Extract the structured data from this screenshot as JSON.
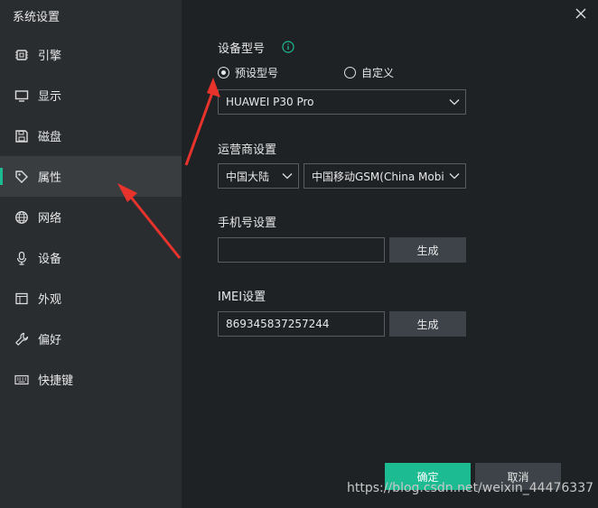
{
  "window": {
    "title": "系统设置"
  },
  "sidebar": {
    "items": [
      {
        "label": "引擎",
        "icon": "chip-icon"
      },
      {
        "label": "显示",
        "icon": "monitor-icon"
      },
      {
        "label": "磁盘",
        "icon": "floppy-disk-icon"
      },
      {
        "label": "属性",
        "icon": "tag-icon",
        "active": true
      },
      {
        "label": "网络",
        "icon": "globe-icon"
      },
      {
        "label": "设备",
        "icon": "microphone-icon"
      },
      {
        "label": "外观",
        "icon": "window-icon"
      },
      {
        "label": "偏好",
        "icon": "wrench-icon"
      },
      {
        "label": "快捷键",
        "icon": "keyboard-icon"
      }
    ]
  },
  "device_model": {
    "title": "设备型号",
    "radio_preset": "预设型号",
    "radio_custom": "自定义",
    "selected_radio": "preset",
    "model_value": "HUAWEI P30 Pro"
  },
  "carrier": {
    "title": "运营商设置",
    "region_value": "中国大陆",
    "carrier_value": "中国移动GSM(China Mobi"
  },
  "phone": {
    "title": "手机号设置",
    "value": "",
    "generate_label": "生成"
  },
  "imei": {
    "title": "IMEI设置",
    "value": "869345837257244",
    "generate_label": "生成"
  },
  "footer": {
    "ok_label": "确定",
    "cancel_label": "取消"
  },
  "watermark": "https://blog.csdn.net/weixin_44476337",
  "colors": {
    "accent": "#1dbb92",
    "annotation_arrow": "#e8322c"
  }
}
